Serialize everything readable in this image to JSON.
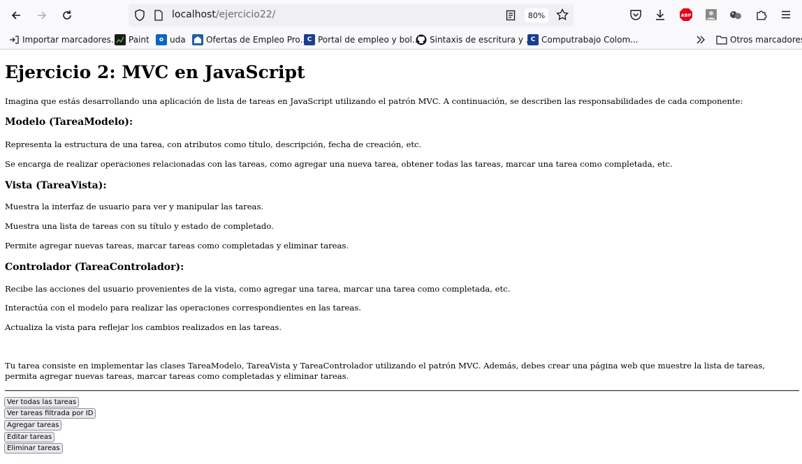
{
  "browser": {
    "url_host": "localhost",
    "url_path": "/ejercicio22/",
    "zoom": "80%"
  },
  "bookmarks": {
    "items": [
      {
        "label": "Importar marcadores...",
        "icon": "import-icon"
      },
      {
        "label": "Paint",
        "icon": "paint-icon"
      },
      {
        "label": "uda",
        "icon": "outlook-icon"
      },
      {
        "label": "Ofertas de Empleo Pro...",
        "icon": "job-offers-icon"
      },
      {
        "label": "Portal de empleo y bol...",
        "icon": "portal-icon"
      },
      {
        "label": "Sintaxis de escritura y ...",
        "icon": "github-icon"
      },
      {
        "label": "Computrabajo Colom...",
        "icon": "computrabajo-icon"
      }
    ],
    "other_label": "Otros marcadores"
  },
  "page": {
    "title": "Ejercicio 2: MVC en JavaScript",
    "intro": "Imagina que estás desarrollando una aplicación de lista de tareas en JavaScript utilizando el patrón MVC. A continuación, se describen las responsabilidades de cada componente:",
    "sections": [
      {
        "heading": "Modelo (TareaModelo):",
        "paragraphs": [
          "Representa la estructura de una tarea, con atributos como título, descripción, fecha de creación, etc.",
          "Se encarga de realizar operaciones relacionadas con las tareas, como agregar una nueva tarea, obtener todas las tareas, marcar una tarea como completada, etc."
        ]
      },
      {
        "heading": "Vista (TareaVista):",
        "paragraphs": [
          "Muestra la interfaz de usuario para ver y manipular las tareas.",
          "Muestra una lista de tareas con su título y estado de completado.",
          "Permite agregar nuevas tareas, marcar tareas como completadas y eliminar tareas."
        ]
      },
      {
        "heading": "Controlador (TareaControlador):",
        "paragraphs": [
          "Recibe las acciones del usuario provenientes de la vista, como agregar una tarea, marcar una tarea como completada, etc.",
          "Interactúa con el modelo para realizar las operaciones correspondientes en las tareas.",
          "Actualiza la vista para reflejar los cambios realizados en las tareas."
        ]
      }
    ],
    "task": "Tu tarea consiste en implementar las clases TareaModelo, TareaVista y TareaControlador utilizando el patrón MVC. Además, debes crear una página web que muestre la lista de tareas, permita agregar nuevas tareas, marcar tareas como completadas y eliminar tareas.",
    "buttons": [
      "Ver todas las tareas",
      "Ver tareas filtrada por ID",
      "Agregar tareas",
      "Editar tareas",
      "Eliminar tareas"
    ]
  }
}
